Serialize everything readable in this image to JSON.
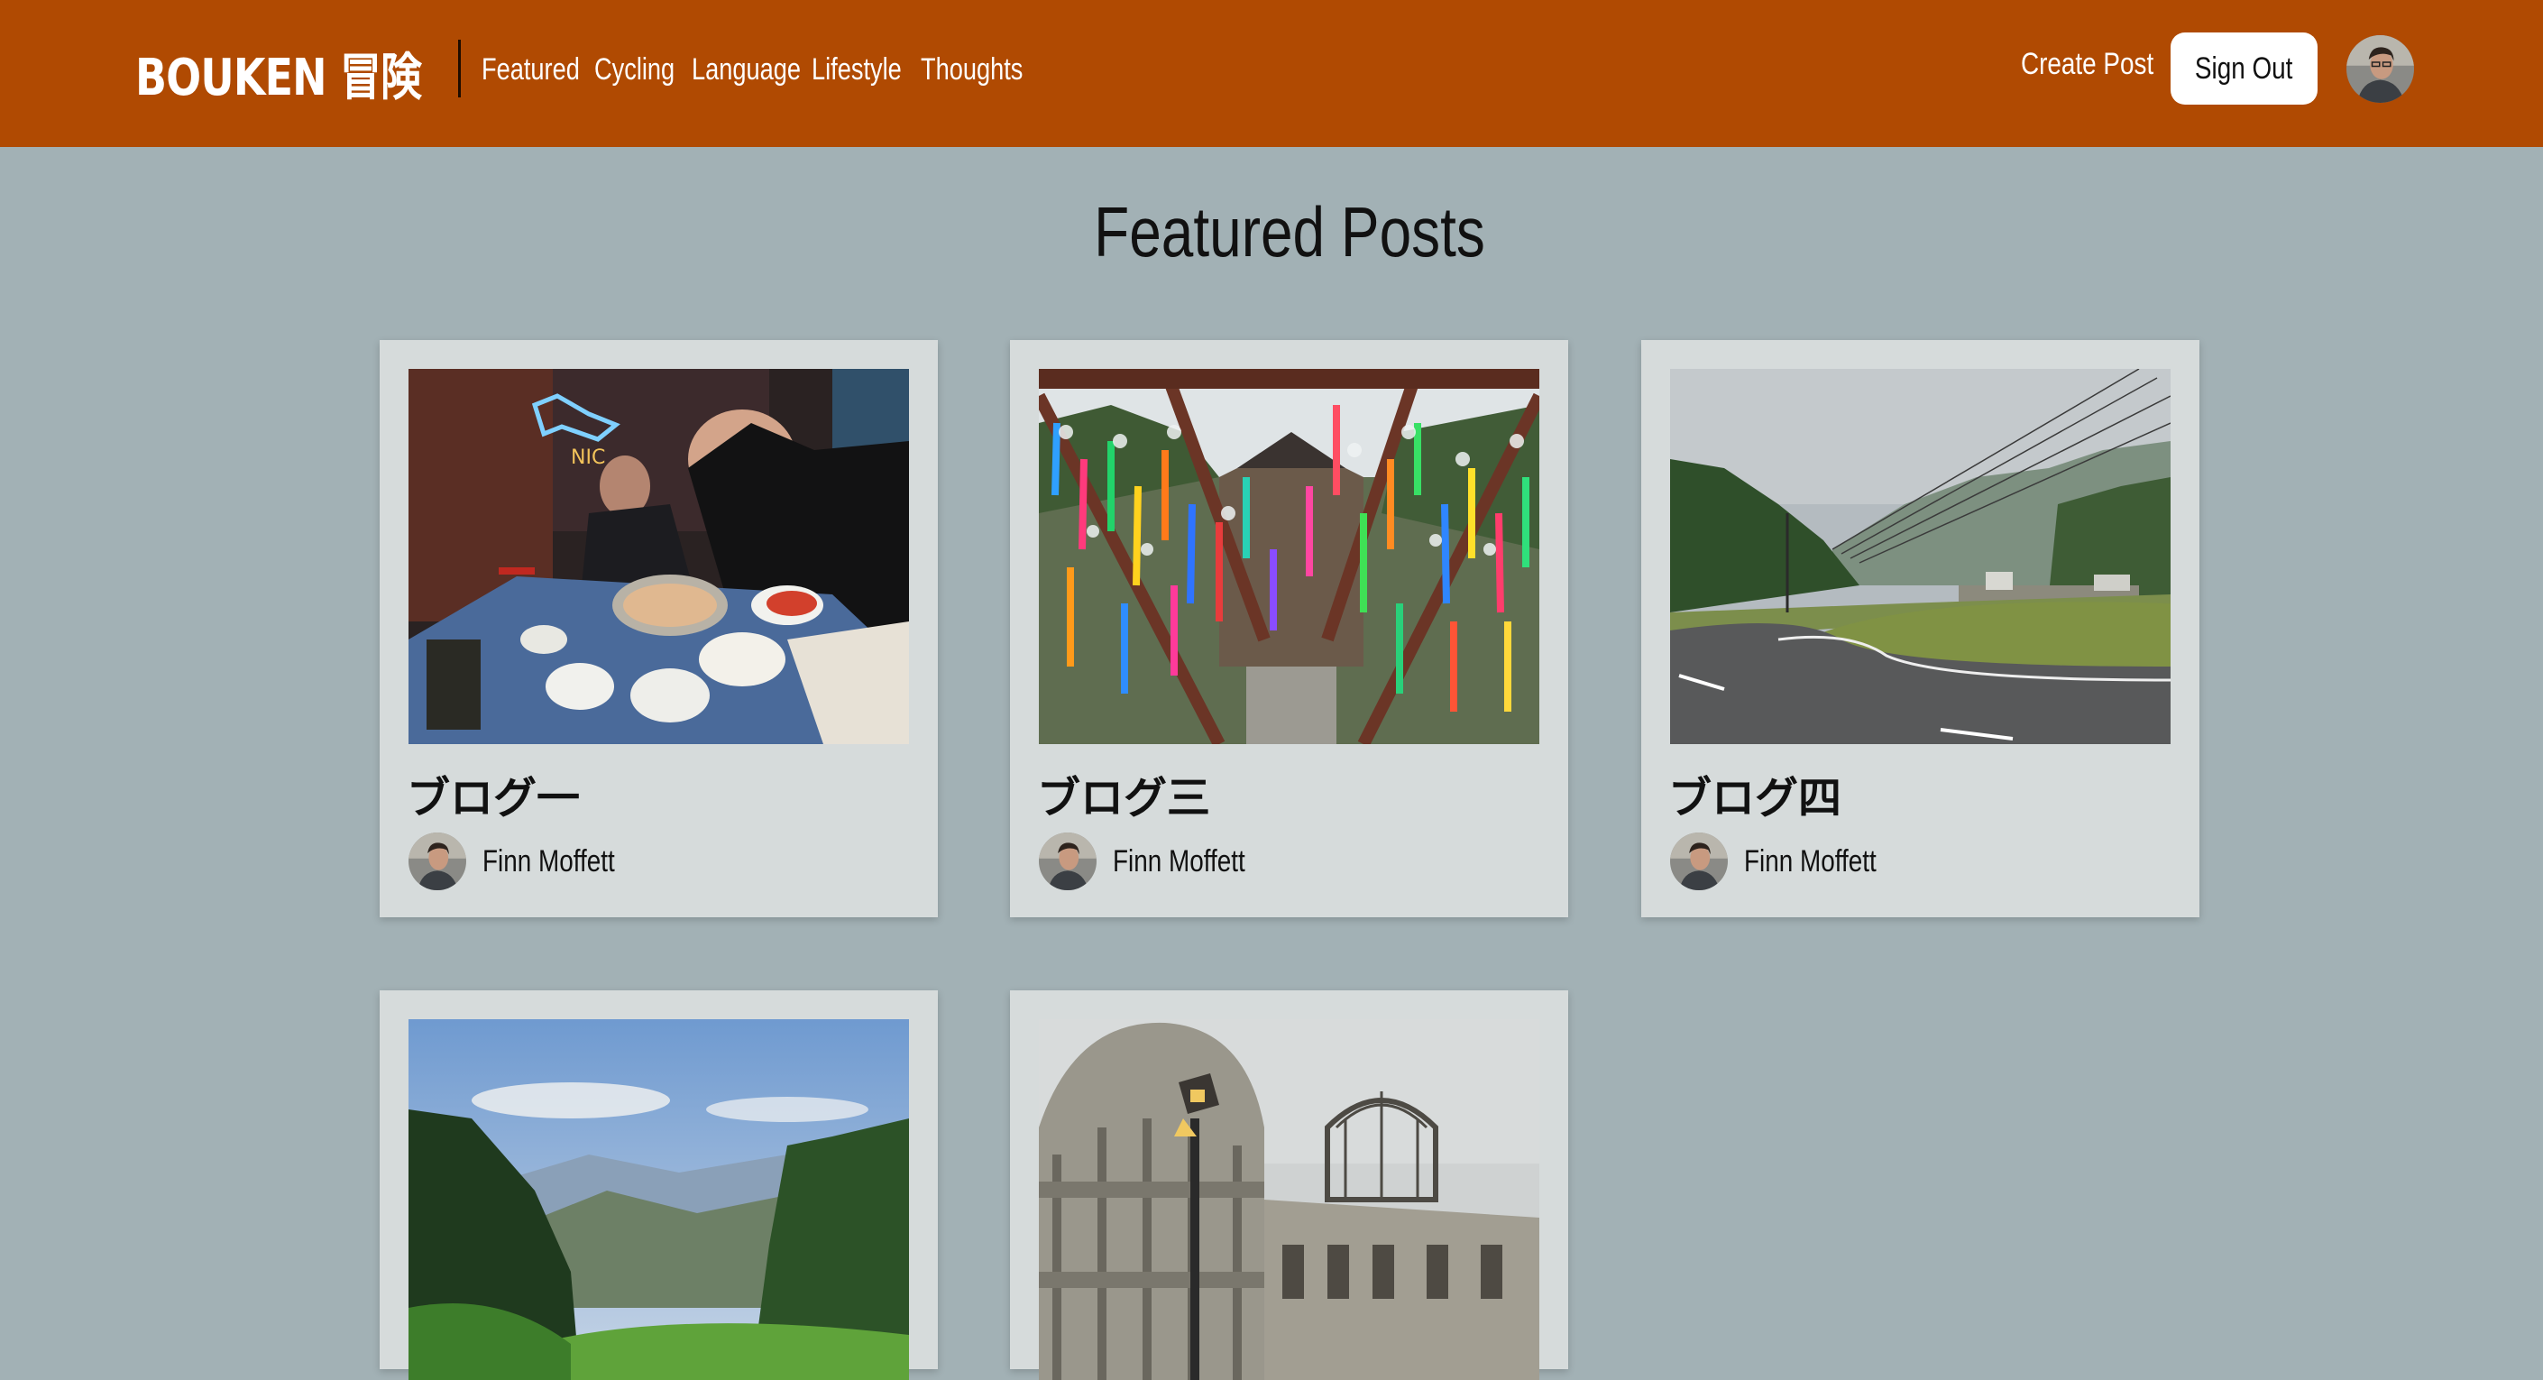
{
  "header": {
    "brand": "BOUKEN 冒険",
    "nav": [
      "Featured",
      "Cycling",
      "Language",
      "Lifestyle",
      "Thoughts"
    ],
    "create_post": "Create Post",
    "sign_out": "Sign Out"
  },
  "main": {
    "title": "Featured Posts",
    "posts": [
      {
        "title": "ブログ一",
        "author": "Finn Moffett"
      },
      {
        "title": "ブログ三",
        "author": "Finn Moffett"
      },
      {
        "title": "ブログ四",
        "author": "Finn Moffett"
      },
      {
        "title": "",
        "author": ""
      },
      {
        "title": "",
        "author": ""
      }
    ]
  },
  "colors": {
    "header_bg": "#b04a02",
    "page_bg": "#a2b1b5",
    "card_bg": "#d6dbdb"
  }
}
